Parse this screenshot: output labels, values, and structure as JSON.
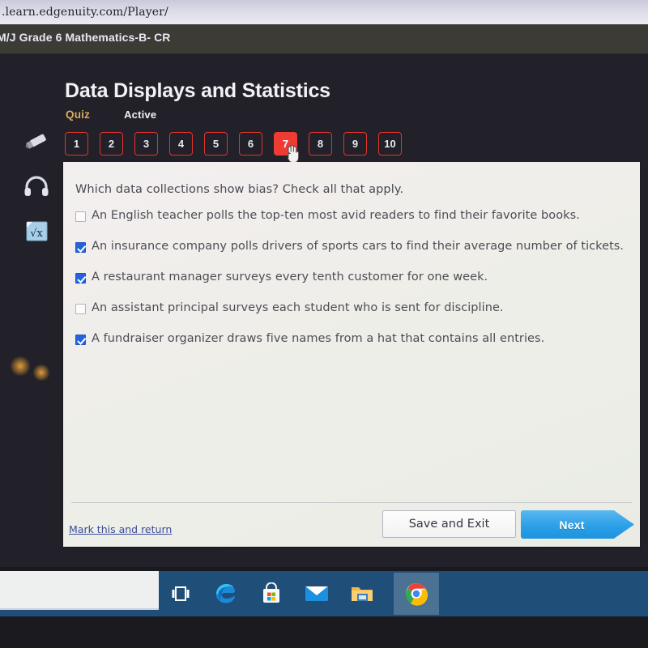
{
  "browser": {
    "url": ".learn.edgenuity.com/Player/"
  },
  "course": {
    "title": "M/J Grade 6 Mathematics-B- CR"
  },
  "lesson": {
    "heading": "Data Displays and Statistics",
    "type_label": "Quiz",
    "status_label": "Active"
  },
  "question_nav": {
    "numbers": [
      "1",
      "2",
      "3",
      "4",
      "5",
      "6",
      "7",
      "8",
      "9",
      "10"
    ],
    "active_index": 6
  },
  "tools": [
    {
      "name": "highlighter-icon",
      "label": "Highlighter"
    },
    {
      "name": "headphones-icon",
      "label": "Text to speech"
    },
    {
      "name": "calculator-icon",
      "label": "Calculator"
    }
  ],
  "question": {
    "prompt": "Which data collections show bias? Check all that apply.",
    "options": [
      {
        "text": "An English teacher polls the top-ten most avid readers to find their favorite books.",
        "checked": false
      },
      {
        "text": "An insurance company polls drivers of sports cars to find their average number of tickets.",
        "checked": true
      },
      {
        "text": "A restaurant manager surveys every tenth customer for one week.",
        "checked": true
      },
      {
        "text": "An assistant principal surveys each student who is sent for discipline.",
        "checked": false
      },
      {
        "text": "A fundraiser organizer draws five names from a hat that contains all entries.",
        "checked": true
      }
    ]
  },
  "footer": {
    "mark_link": "Mark this and return",
    "save_button": "Save and Exit",
    "next_button": "Next"
  },
  "taskbar": {
    "search_placeholder": "",
    "icons": [
      {
        "name": "task-view-icon",
        "label": "Task View"
      },
      {
        "name": "edge-icon",
        "label": "Microsoft Edge"
      },
      {
        "name": "microsoft-store-icon",
        "label": "Microsoft Store"
      },
      {
        "name": "mail-icon",
        "label": "Mail"
      },
      {
        "name": "file-explorer-icon",
        "label": "File Explorer"
      },
      {
        "name": "chrome-icon",
        "label": "Google Chrome"
      }
    ],
    "active_icon_index": 5
  },
  "colors": {
    "accent_red": "#ef3b34",
    "accent_blue": "#2ba0e8",
    "checkbox_blue": "#2563dd",
    "quiz_gold": "#d7ab5e",
    "taskbar_blue": "#1f4e79"
  }
}
